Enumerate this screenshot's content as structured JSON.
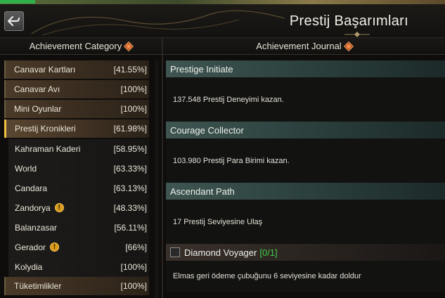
{
  "header": {
    "title": "Prestij Başarımları",
    "back_icon": "back-arrow-icon"
  },
  "columns": {
    "left_title": "Achievement Category",
    "right_title": "Achievement Journal"
  },
  "categories": [
    {
      "label": "Canavar Kartları",
      "pct": "[41.55%]",
      "level": "top",
      "warn": false,
      "active": false
    },
    {
      "label": "Canavar Avı",
      "pct": "[100%]",
      "level": "top",
      "warn": false,
      "active": false
    },
    {
      "label": "Mini Oyunlar",
      "pct": "[100%]",
      "level": "top",
      "warn": false,
      "active": false
    },
    {
      "label": "Prestij Kronikleri",
      "pct": "[61.98%]",
      "level": "top",
      "warn": false,
      "active": true
    },
    {
      "label": "Kahraman Kaderi",
      "pct": "[58.95%]",
      "level": "sub",
      "warn": false,
      "active": false
    },
    {
      "label": "World",
      "pct": "[63.33%]",
      "level": "sub",
      "warn": false,
      "active": false
    },
    {
      "label": "Candara",
      "pct": "[63.13%]",
      "level": "sub",
      "warn": false,
      "active": false
    },
    {
      "label": "Zandorya",
      "pct": "[48.33%]",
      "level": "sub",
      "warn": true,
      "active": false
    },
    {
      "label": "Balanzasar",
      "pct": "[56.11%]",
      "level": "sub",
      "warn": false,
      "active": false
    },
    {
      "label": "Gerador",
      "pct": "[66%]",
      "level": "sub",
      "warn": true,
      "active": false
    },
    {
      "label": "Kolydia",
      "pct": "[100%]",
      "level": "sub",
      "warn": false,
      "active": false
    },
    {
      "label": "Tüketimlikler",
      "pct": "[100%]",
      "level": "top",
      "warn": false,
      "active": false
    }
  ],
  "journal": [
    {
      "title": "Prestige Initiate",
      "desc": "137.548 Prestij Deneyimi kazan.",
      "locked": false,
      "count": ""
    },
    {
      "title": "Courage Collector",
      "desc": "103.980 Prestij Para Birimi kazan.",
      "locked": false,
      "count": ""
    },
    {
      "title": "Ascendant Path",
      "desc": "17 Prestij Seviyesine Ulaş",
      "locked": false,
      "count": ""
    },
    {
      "title": "Diamond Voyager",
      "desc": "Elmas geri ödeme çubuğunu 6 seviyesine kadar doldur",
      "locked": true,
      "count": "[0/1]"
    }
  ],
  "colors": {
    "teal_header": "#3f5552",
    "active_marker": "#f0c040",
    "progress_green": "#3fce4a",
    "warn": "#d99a1a"
  }
}
